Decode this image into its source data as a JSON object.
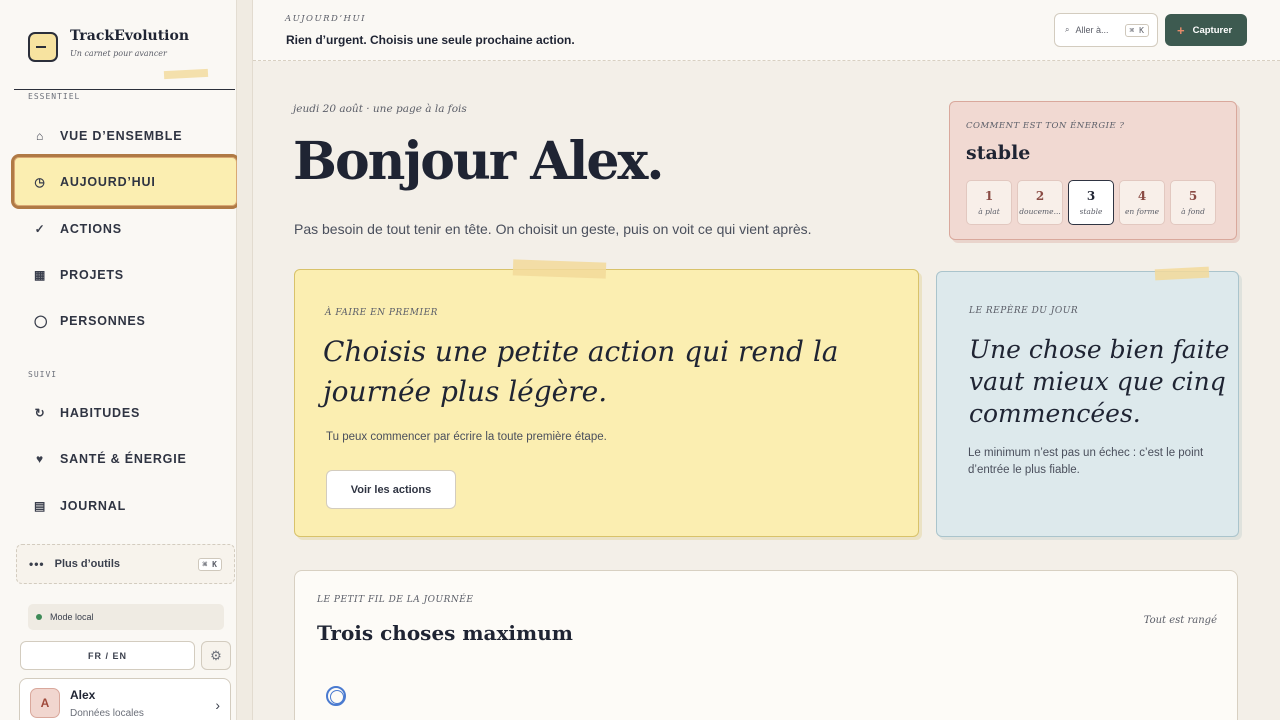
{
  "brand": {
    "name": "TrackEvolution",
    "tagline": "Un carnet pour avancer"
  },
  "sidebar": {
    "section_essentiel": "ESSENTIEL",
    "section_suivi": "SUIVI",
    "items": [
      {
        "label": "VUE D’ENSEMBLE",
        "icon": "⌂"
      },
      {
        "label": "AUJOURD’HUI",
        "icon": "◷"
      },
      {
        "label": "ACTIONS",
        "icon": "✓"
      },
      {
        "label": "PROJETS",
        "icon": "▦"
      },
      {
        "label": "PERSONNES",
        "icon": "◯"
      },
      {
        "label": "HABITUDES",
        "icon": "↻"
      },
      {
        "label": "SANTÉ & ÉNERGIE",
        "icon": "♥"
      },
      {
        "label": "JOURNAL",
        "icon": "▤"
      }
    ],
    "more_tools": "Plus d’outils",
    "more_tools_kbd": "⌘ K",
    "mode": "Mode local",
    "lang": "FR / EN",
    "settings_icon": "⚙",
    "user": {
      "initial": "A",
      "name": "Alex",
      "sub": "Données locales"
    }
  },
  "topbar": {
    "kicker": "AUJOURD’HUI",
    "title": "Rien d’urgent. Choisis une seule prochaine action.",
    "search_label": "Aller à...",
    "search_kbd": "⌘ K",
    "capture": "Capturer"
  },
  "main": {
    "date": "jeudi 20 août · une page à la fois",
    "greeting": "Bonjour Alex.",
    "intro": "Pas besoin de tout tenir en tête. On choisit un geste, puis on voit ce qui vient après.",
    "energy": {
      "question": "COMMENT EST TON ÉNERGIE ?",
      "value": "stable",
      "options": [
        {
          "n": "1",
          "label": "à plat"
        },
        {
          "n": "2",
          "label": "douceme..."
        },
        {
          "n": "3",
          "label": "stable"
        },
        {
          "n": "4",
          "label": "en forme"
        },
        {
          "n": "5",
          "label": "à fond"
        }
      ],
      "selected": 3
    },
    "first": {
      "kicker": "À FAIRE EN PREMIER",
      "headline": "Choisis une petite action qui rend la journée plus légère.",
      "sub": "Tu peux commencer par écrire la toute première étape.",
      "button": "Voir les actions"
    },
    "marker": {
      "kicker": "LE REPÈRE DU JOUR",
      "headline": "Une chose bien faite vaut mieux que cinq commencées.",
      "sub": "Le minimum n’est pas un échec : c’est le point d’entrée le plus fiable."
    },
    "thread": {
      "kicker": "LE PETIT FIL DE LA JOURNÉE",
      "title": "Trois choses maximum",
      "status": "Tout est rangé"
    }
  },
  "colors": {
    "accent": "#3d5a50",
    "active_bg": "#fbeeb1",
    "active_border": "#b07a45"
  }
}
